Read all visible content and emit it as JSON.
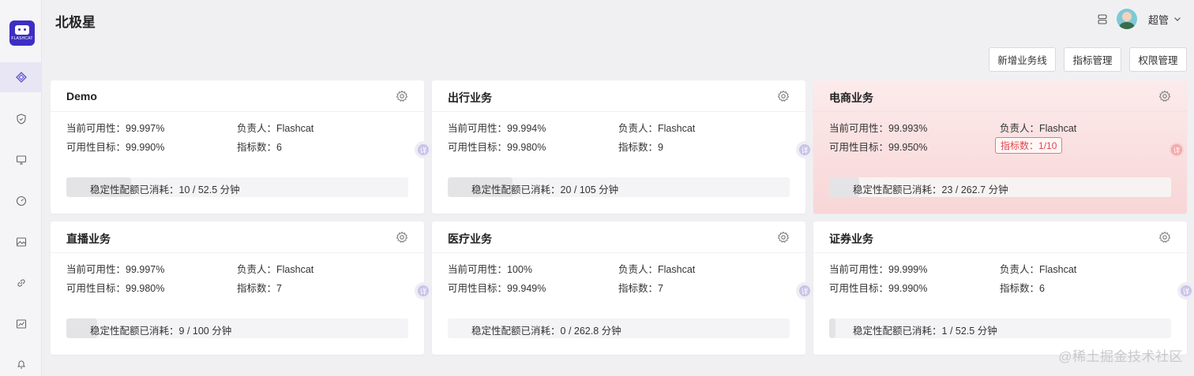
{
  "app": {
    "title": "北极星"
  },
  "user": {
    "name": "超管"
  },
  "icons": {
    "logo": "flashcat-logo",
    "nav": [
      "diamond-icon",
      "shield-icon",
      "monitor-icon",
      "dashboard-icon",
      "image-icon",
      "link-icon",
      "chart-icon",
      "bell-icon"
    ],
    "settings": "gear-icon",
    "detail": "detail-badge-icon",
    "servers": "server-icon",
    "chevron": "chevron-down-icon"
  },
  "logo": {
    "text": "FLASHCAT"
  },
  "toolbar": {
    "add_label": "新增业务线",
    "metrics_label": "指标管理",
    "perm_label": "权限管理"
  },
  "labels": {
    "availability": "当前可用性：",
    "target": "可用性目标：",
    "owner": "负责人：",
    "metric_count": "指标数：",
    "budget": "稳定性配额已消耗：",
    "detail": "详"
  },
  "colors": {
    "accent": "#3c2fc4",
    "alert": "#e2474b",
    "alert_bg": "#fcebec"
  },
  "cards": [
    {
      "title": "Demo",
      "availability": "99.997%",
      "target": "99.990%",
      "owner": "Flashcat",
      "metric_count": "6",
      "budget": "10 / 52.5 分钟",
      "alert": false
    },
    {
      "title": "出行业务",
      "availability": "99.994%",
      "target": "99.980%",
      "owner": "Flashcat",
      "metric_count": "9",
      "budget": "20 / 105 分钟",
      "alert": false
    },
    {
      "title": "电商业务",
      "availability": "99.993%",
      "target": "99.950%",
      "owner": "Flashcat",
      "metric_count": "1/10",
      "budget": "23 / 262.7 分钟",
      "alert": true
    },
    {
      "title": "直播业务",
      "availability": "99.997%",
      "target": "99.980%",
      "owner": "Flashcat",
      "metric_count": "7",
      "budget": "9 / 100 分钟",
      "alert": false
    },
    {
      "title": "医疗业务",
      "availability": "100%",
      "target": "99.949%",
      "owner": "Flashcat",
      "metric_count": "7",
      "budget": "0 / 262.8 分钟",
      "alert": false
    },
    {
      "title": "证券业务",
      "availability": "99.999%",
      "target": "99.990%",
      "owner": "Flashcat",
      "metric_count": "6",
      "budget": "1 / 52.5 分钟",
      "alert": false
    }
  ],
  "watermark": "@稀土掘金技术社区"
}
